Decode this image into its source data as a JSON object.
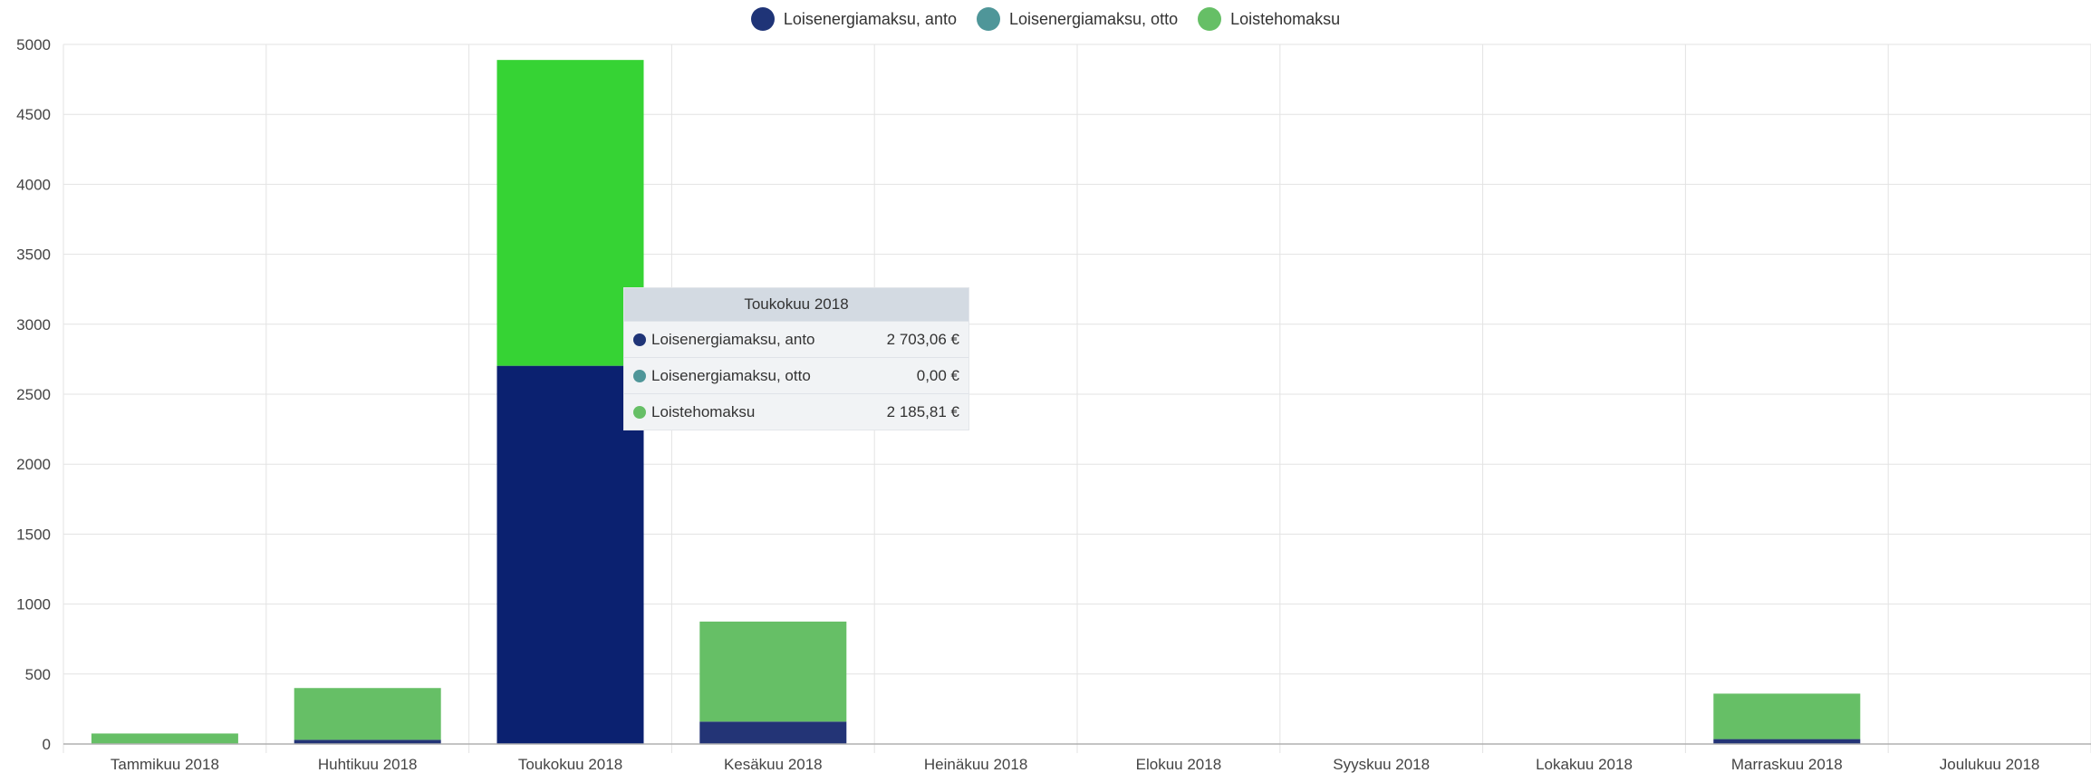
{
  "colors": {
    "anto": "#0b2170",
    "otto": "#4f9699",
    "loisteho": "#66bf66",
    "loisteho_highlight": "#36d334",
    "anto_bar": "#233476",
    "grid": "#e3e3e3",
    "axis_text": "#444444"
  },
  "legend": [
    {
      "label": "Loisenergiamaksu, anto",
      "color": "#1f3477"
    },
    {
      "label": "Loisenergiamaksu, otto",
      "color": "#4f9699"
    },
    {
      "label": "Loistehomaksu",
      "color": "#66bf66"
    }
  ],
  "tooltip": {
    "title": "Toukokuu 2018",
    "rows": [
      {
        "label": "Loisenergiamaksu, anto",
        "value": "2 703,06 €",
        "color": "#1f3477"
      },
      {
        "label": "Loisenergiamaksu, otto",
        "value": "0,00 €",
        "color": "#4f9699"
      },
      {
        "label": "Loistehomaksu",
        "value": "2 185,81 €",
        "color": "#66bf66"
      }
    ]
  },
  "chart_data": {
    "type": "bar",
    "stacked": true,
    "categories": [
      "Tammikuu 2018",
      "Huhtikuu 2018",
      "Toukokuu 2018",
      "Kesäkuu 2018",
      "Heinäkuu 2018",
      "Elokuu 2018",
      "Syyskuu 2018",
      "Lokakuu 2018",
      "Marraskuu 2018",
      "Joulukuu 2018"
    ],
    "series": [
      {
        "name": "Loisenergiamaksu, anto",
        "values": [
          0,
          30,
          2703.06,
          160,
          0,
          0,
          0,
          0,
          35,
          0
        ]
      },
      {
        "name": "Loisenergiamaksu, otto",
        "values": [
          0,
          0,
          0,
          0,
          0,
          0,
          0,
          0,
          0,
          0
        ]
      },
      {
        "name": "Loistehomaksu",
        "values": [
          75,
          370,
          2185.81,
          715,
          0,
          0,
          0,
          0,
          325,
          0
        ]
      }
    ],
    "yticks": [
      0,
      500,
      1000,
      1500,
      2000,
      2500,
      3000,
      3500,
      4000,
      4500,
      5000
    ],
    "ylim": [
      0,
      5000
    ],
    "highlighted_category": "Toukokuu 2018",
    "grid": true,
    "legend_position": "top-center"
  }
}
